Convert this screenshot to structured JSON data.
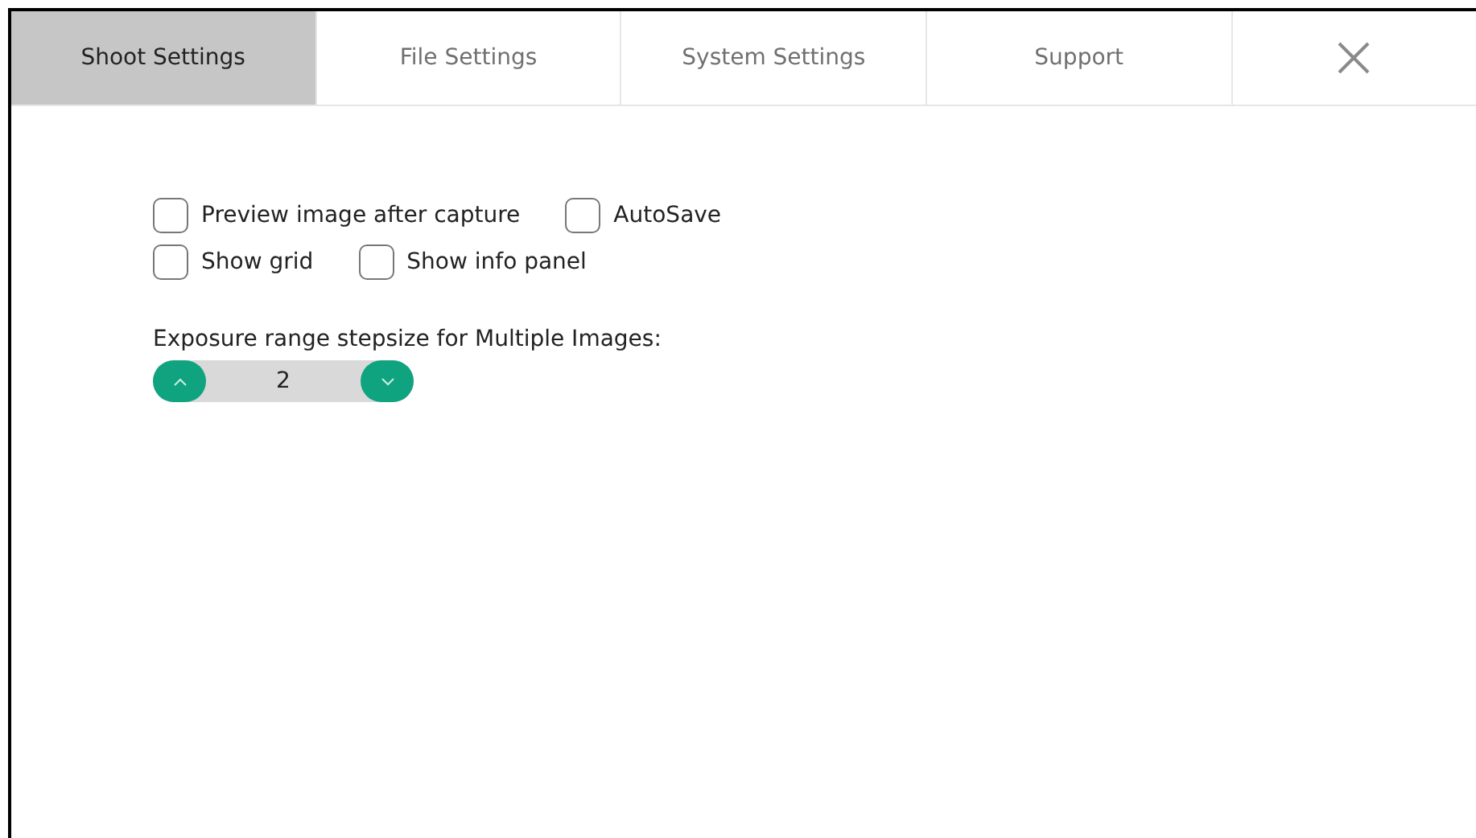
{
  "tabs": [
    {
      "label": "Shoot Settings",
      "selected": true
    },
    {
      "label": "File Settings",
      "selected": false
    },
    {
      "label": "System Settings",
      "selected": false
    },
    {
      "label": "Support",
      "selected": false
    }
  ],
  "checkbox_rows": [
    [
      {
        "label": "Preview image after capture",
        "checked": false
      },
      {
        "label": "AutoSave",
        "checked": false
      }
    ],
    [
      {
        "label": "Show grid",
        "checked": false
      },
      {
        "label": "Show info panel",
        "checked": false
      }
    ]
  ],
  "stepper": {
    "label": "Exposure range stepsize for Multiple Images:",
    "value": "2"
  }
}
